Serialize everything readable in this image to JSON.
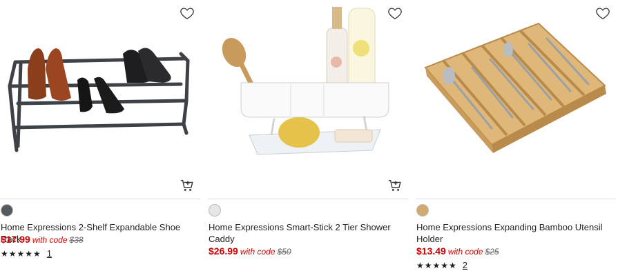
{
  "products": [
    {
      "title": "Home Expressions 2-Shelf Expandable Shoe Rack",
      "price": "$17.99",
      "with_code": "with code",
      "original_price": "$38",
      "swatch_color": "#555a60",
      "rating_stars": "★★★★★",
      "rating_count": "1"
    },
    {
      "title": "Home Expressions Smart-Stick 2 Tier Shower Caddy",
      "price": "$26.99",
      "with_code": "with code",
      "original_price": "$50",
      "swatch_color": "#e6e6e6"
    },
    {
      "title": "Home Expressions Expanding Bamboo Utensil Holder",
      "price": "$13.49",
      "with_code": "with code",
      "original_price": "$25",
      "swatch_color": "#d2aa6e",
      "rating_stars": "★★★★★",
      "rating_count": "2"
    }
  ],
  "icons": {
    "favorite": "heart-icon",
    "add_to_cart": "add-to-cart-icon"
  },
  "colors": {
    "sale_price": "#cc0000"
  }
}
